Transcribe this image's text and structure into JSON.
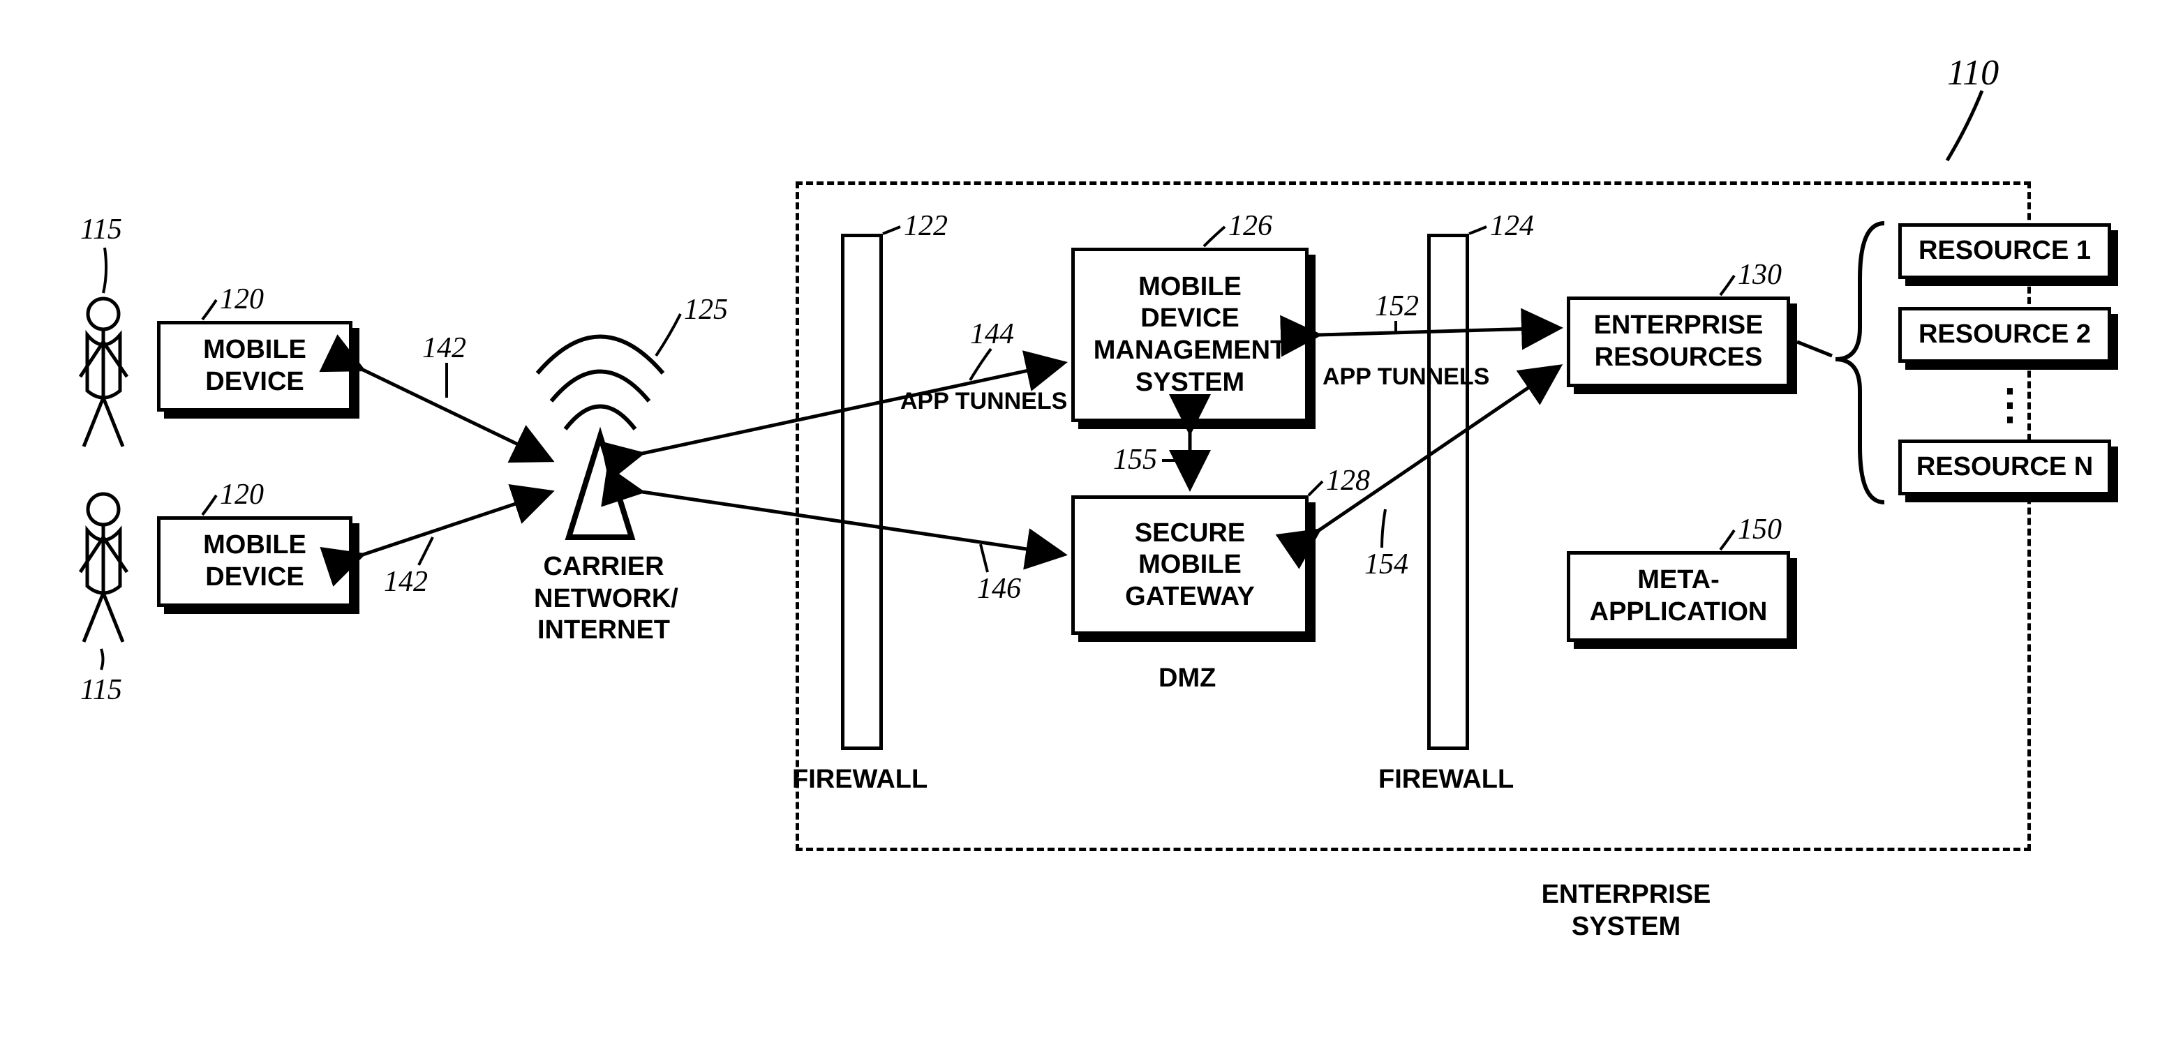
{
  "figure_ref": "110",
  "users": {
    "ref": "115"
  },
  "mobile_device": {
    "label": "MOBILE\nDEVICE",
    "ref": "120"
  },
  "carrier": {
    "label": "CARRIER\nNETWORK/\nINTERNET",
    "ref": "125"
  },
  "firewall_left": {
    "label": "FIREWALL",
    "ref": "122"
  },
  "firewall_right": {
    "label": "FIREWALL",
    "ref": "124"
  },
  "mdm": {
    "label": "MOBILE\nDEVICE\nMANAGEMENT\nSYSTEM",
    "ref": "126"
  },
  "smg": {
    "label": "SECURE\nMOBILE\nGATEWAY",
    "ref": "128"
  },
  "dmz": {
    "label": "DMZ"
  },
  "ent_res": {
    "label": "ENTERPRISE\nRESOURCES",
    "ref": "130"
  },
  "meta_app": {
    "label": "META-\nAPPLICATION",
    "ref": "150"
  },
  "resources": [
    {
      "label": "RESOURCE 1"
    },
    {
      "label": "RESOURCE 2"
    },
    {
      "label": "RESOURCE N"
    }
  ],
  "dots": "⋮",
  "enterprise": {
    "label": "ENTERPRISE\nSYSTEM"
  },
  "conn": {
    "r142": "142",
    "r144": "144",
    "r146": "146",
    "r152": "152",
    "r154": "154",
    "r155": "155",
    "app_tunnels": "APP TUNNELS"
  }
}
